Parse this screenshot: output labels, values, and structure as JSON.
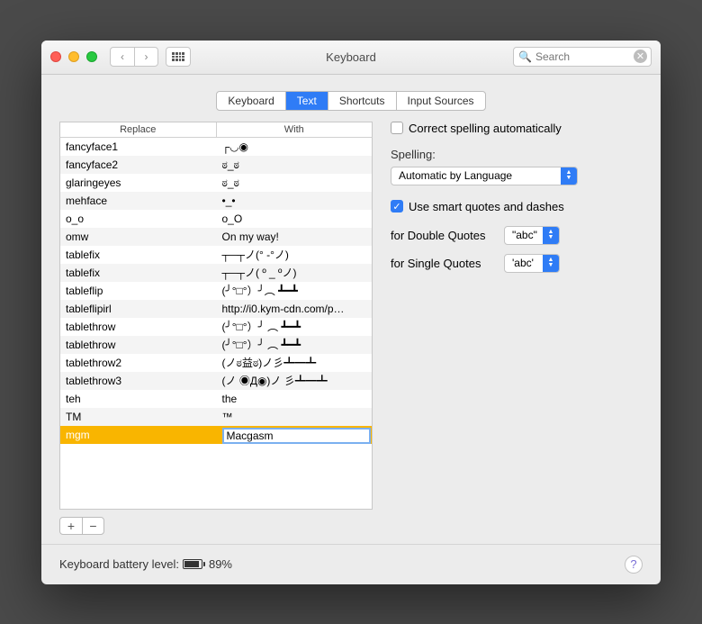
{
  "window": {
    "title": "Keyboard"
  },
  "search": {
    "placeholder": "Search"
  },
  "tabs": [
    "Keyboard",
    "Text",
    "Shortcuts",
    "Input Sources"
  ],
  "activeTab": 1,
  "table": {
    "headers": {
      "replace": "Replace",
      "with": "With"
    },
    "rows": [
      {
        "r": "fancyface1",
        "w": "┌◡◉"
      },
      {
        "r": "fancyface2",
        "w": "ಠ_ಠ"
      },
      {
        "r": "glaringeyes",
        "w": "ಠ_ಠ"
      },
      {
        "r": "mehface",
        "w": "•_•"
      },
      {
        "r": "o_o",
        "w": "o_O"
      },
      {
        "r": "omw",
        "w": "On my way!"
      },
      {
        "r": "tablefix",
        "w": "┬─┬ノ(° -°ノ)"
      },
      {
        "r": "tablefix",
        "w": "┬─┬ノ( º _ ºノ)"
      },
      {
        "r": "tableflip",
        "w": "(╯°□°）╯︵ ┻━┻"
      },
      {
        "r": "tableflipirl",
        "w": "http://i0.kym-cdn.com/p…"
      },
      {
        "r": "tablethrow",
        "w": "(╯°□°）╯ ︵ ┻━┻"
      },
      {
        "r": "tablethrow",
        "w": "(╯°□°）╯ ︵ ┻━┻"
      },
      {
        "r": "tablethrow2",
        "w": "(ノಠ益ಠ)ノ彡┻━┻"
      },
      {
        "r": "tablethrow3",
        "w": "(ノ ◉Д◉)ノ 彡┻━┻"
      },
      {
        "r": "teh",
        "w": "the"
      },
      {
        "r": "TM",
        "w": "™"
      }
    ],
    "editing": {
      "r": "mgm",
      "w": "Macgasm"
    }
  },
  "side": {
    "correctSpelling": {
      "label": "Correct spelling automatically",
      "checked": false
    },
    "spellingLabel": "Spelling:",
    "spellingValue": "Automatic by Language",
    "smartQuotes": {
      "label": "Use smart quotes and dashes",
      "checked": true
    },
    "doubleLabel": "for Double Quotes",
    "doubleValue": "\"abc\"",
    "singleLabel": "for Single Quotes",
    "singleValue": "'abc'"
  },
  "footer": {
    "batteryLabel": "Keyboard battery level:",
    "batteryPct": "89%",
    "batteryFill": 89
  }
}
